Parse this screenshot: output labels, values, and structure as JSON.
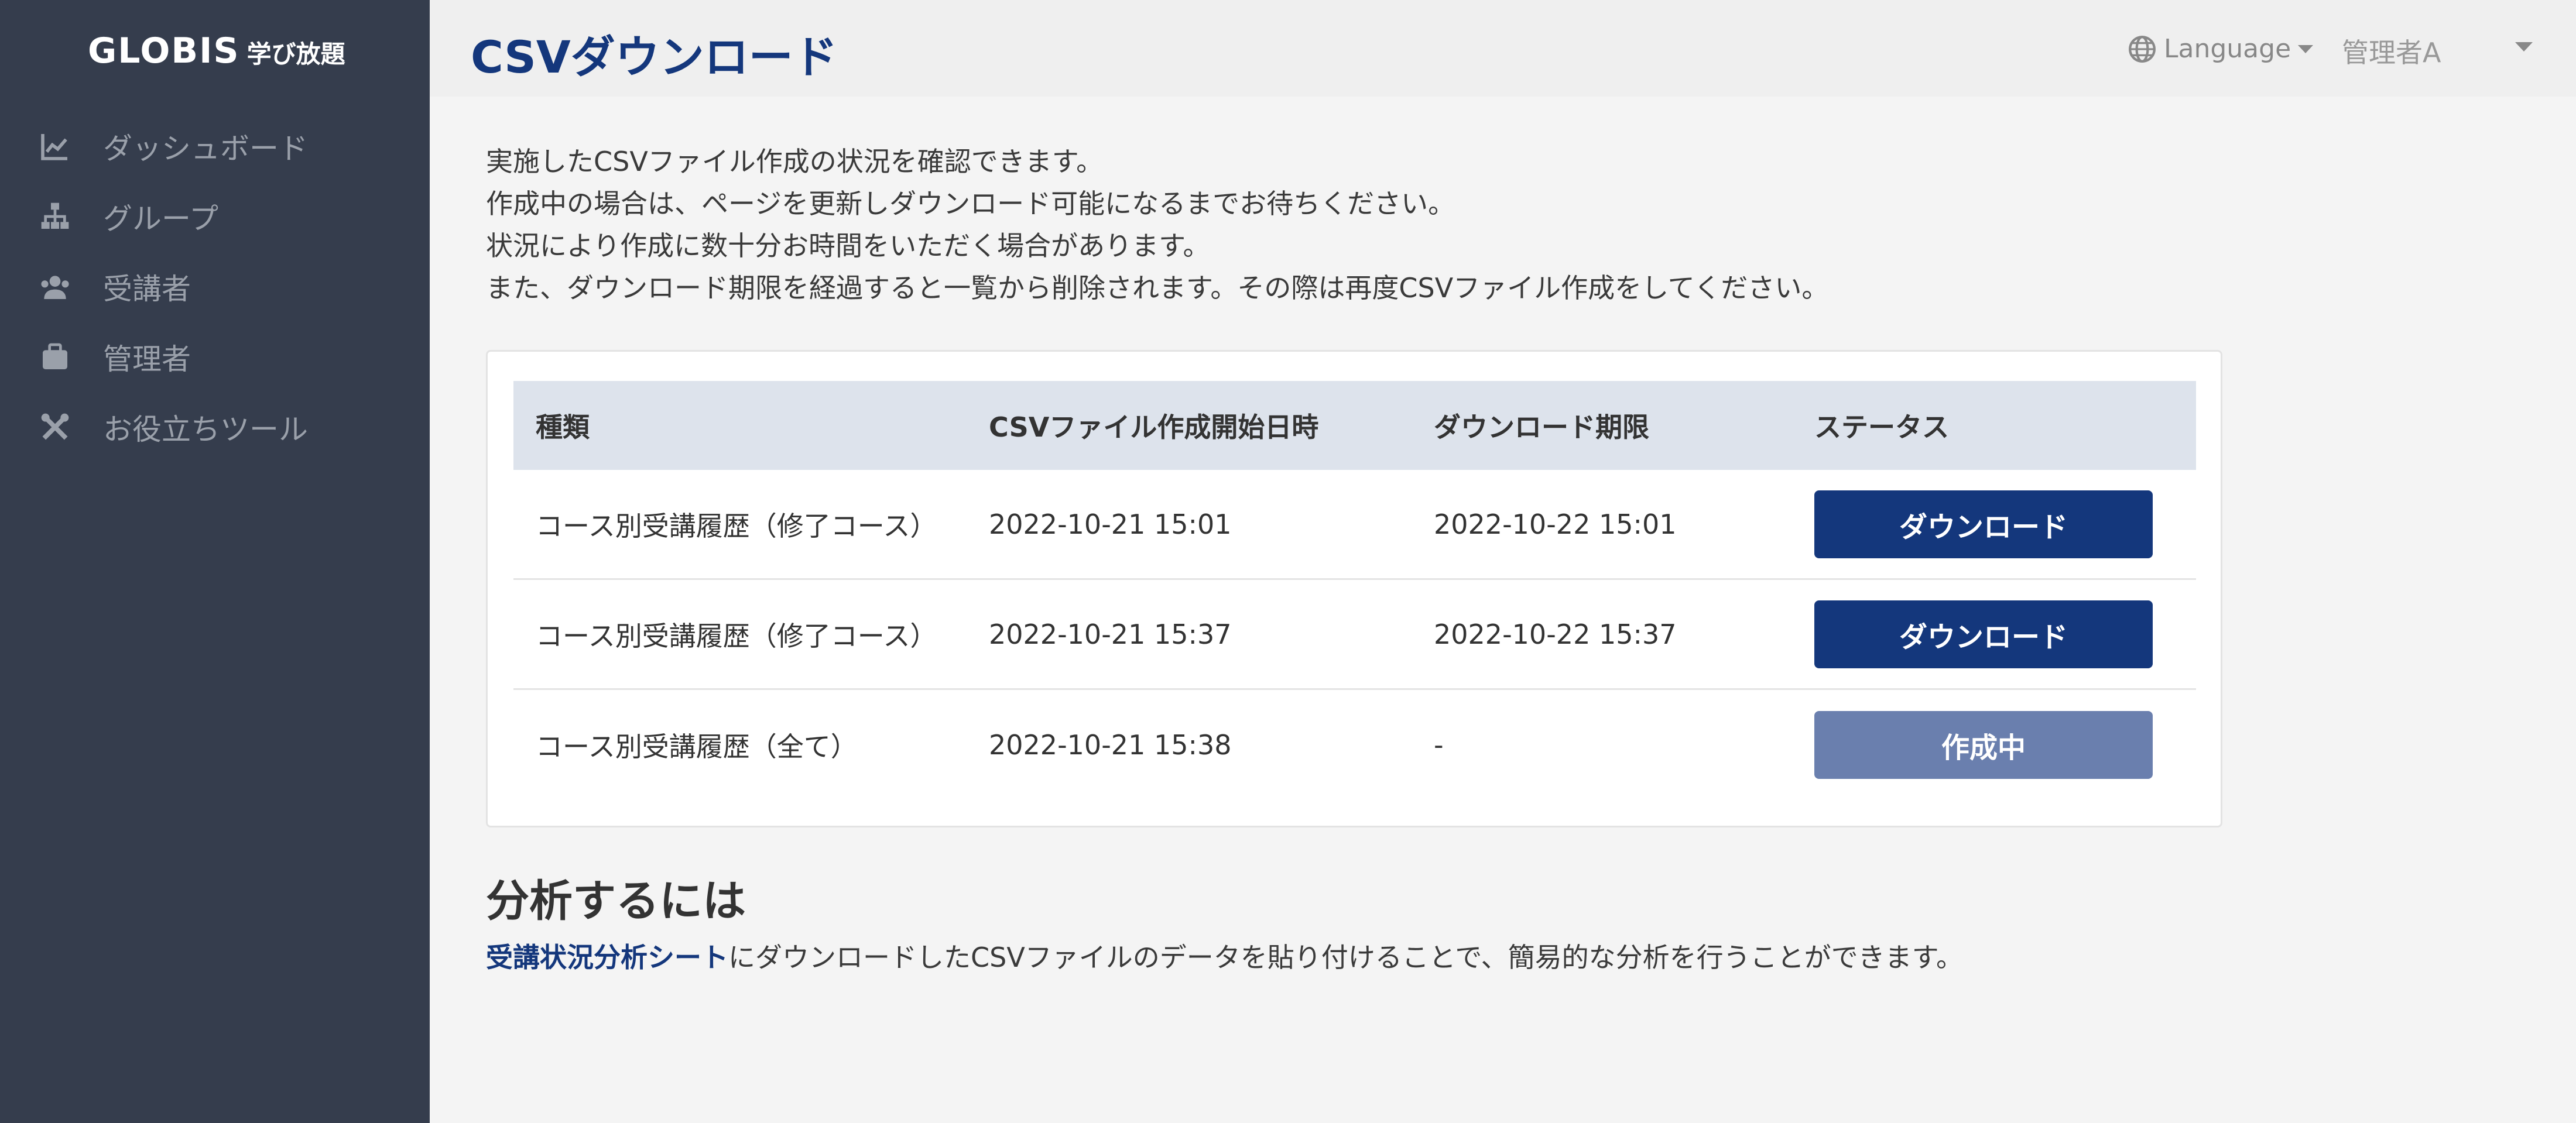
{
  "brand": {
    "name": "GLOBIS",
    "sub": "学び放題"
  },
  "sidebar": {
    "items": [
      {
        "label": "ダッシュボード",
        "icon": "chart-line-icon"
      },
      {
        "label": "グループ",
        "icon": "sitemap-icon"
      },
      {
        "label": "受講者",
        "icon": "users-icon"
      },
      {
        "label": "管理者",
        "icon": "briefcase-icon"
      },
      {
        "label": "お役立ちツール",
        "icon": "tools-icon"
      }
    ]
  },
  "header": {
    "title": "CSVダウンロード",
    "language_label": "Language",
    "user_label": "管理者A"
  },
  "intro": {
    "lines": [
      "実施したCSVファイル作成の状況を確認できます。",
      "作成中の場合は、ページを更新しダウンロード可能になるまでお待ちください。",
      "状況により作成に数十分お時間をいただく場合があります。",
      "また、ダウンロード期限を経過すると一覧から削除されます。その際は再度CSVファイル作成をしてください。"
    ]
  },
  "table": {
    "headers": [
      "種類",
      "CSVファイル作成開始日時",
      "ダウンロード期限",
      "ステータス"
    ],
    "rows": [
      {
        "type": "コース別受講履歴（修了コース）",
        "created": "2022-10-21 15:01",
        "expires": "2022-10-22 15:01",
        "status": "ダウンロード"
      },
      {
        "type": "コース別受講履歴（修了コース）",
        "created": "2022-10-21 15:37",
        "expires": "2022-10-22 15:37",
        "status": "ダウンロード"
      },
      {
        "type": "コース別受講履歴（全て）",
        "created": "2022-10-21 15:38",
        "expires": "-",
        "status": "作成中"
      }
    ]
  },
  "analysis": {
    "title": "分析するには",
    "link_text": "受講状況分析シート",
    "text": "にダウンロードしたCSVファイルのデータを貼り付けることで、簡易的な分析を行うことができます。"
  },
  "colors": {
    "sidebar_bg": "#353d4d",
    "accent": "#14377c",
    "button_disabled": "#6a7fae",
    "table_header_bg": "#dde3ec"
  }
}
